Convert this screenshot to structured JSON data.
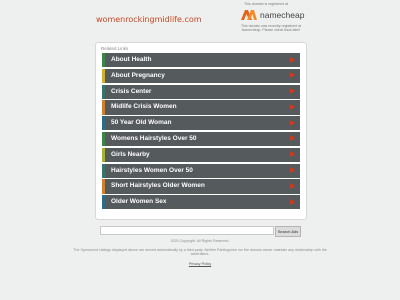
{
  "header": {
    "domain": "womenrockingmidlife.com",
    "registrar_note": "This domain is registered at",
    "registrar_name": "namecheap",
    "registrar_detail": "This domain was recently registered at Namecheap. Please check back later!"
  },
  "panel": {
    "title": "Related Links",
    "links": [
      {
        "label": "About Health",
        "color": "#2f8f3f"
      },
      {
        "label": "About Pregnancy",
        "color": "#d9b20f"
      },
      {
        "label": "Crisis Center",
        "color": "#2c7a6f"
      },
      {
        "label": "Midlife Crisis Women",
        "color": "#e07c14"
      },
      {
        "label": "50 Year Old Woman",
        "color": "#1f6f8f"
      },
      {
        "label": "Womens Hairstyles Over 50",
        "color": "#2f8f3f"
      },
      {
        "label": "Girls Nearby",
        "color": "#a6b817"
      },
      {
        "label": "Hairstyles Women Over 50",
        "color": "#2c7a6f"
      },
      {
        "label": "Short Hairstyles Older Women",
        "color": "#e07c14"
      },
      {
        "label": "Older Women Sex",
        "color": "#1f6f8f"
      }
    ],
    "arrow_color": "#e0341a"
  },
  "search": {
    "input_value": "",
    "button_label": "Search Ads"
  },
  "footer": {
    "copyright": "2020 Copyright. All Rights Reserved.",
    "disclaimer": "The Sponsored Listings displayed above are served automatically by a third party. Neither Parkingcrew nor the domain owner maintain any relationship with the advertisers.",
    "privacy": "Privacy Policy"
  }
}
